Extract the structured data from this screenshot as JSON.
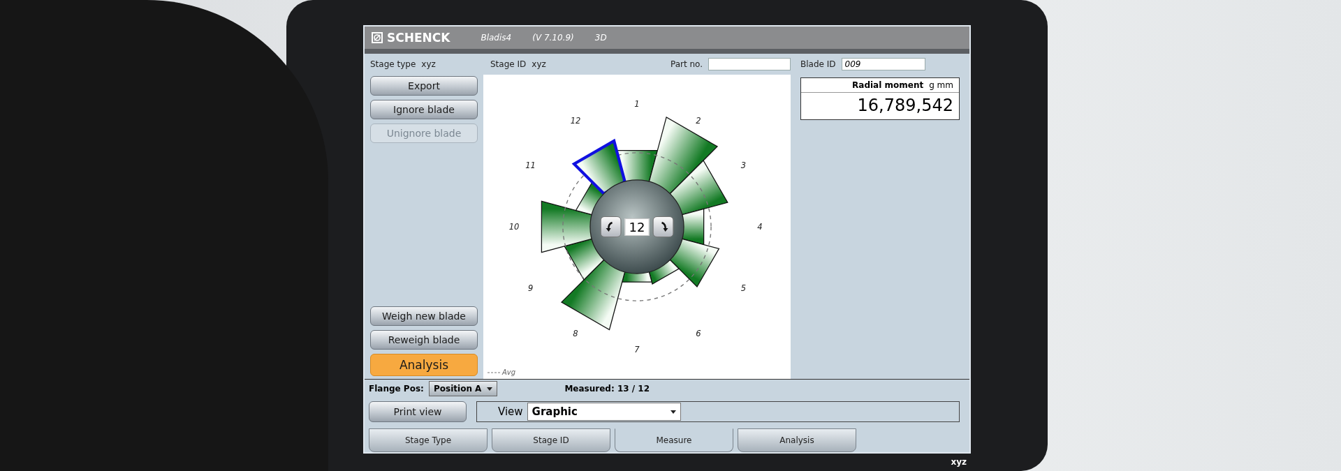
{
  "title_bar": {
    "logo": "SCHENCK",
    "app": "Bladis4",
    "version": "(V 7.10.9)",
    "mode": "3D"
  },
  "stage_type": {
    "label": "Stage type",
    "value": "xyz"
  },
  "stage_id": {
    "label": "Stage ID",
    "value": "xyz"
  },
  "part_no": {
    "label": "Part no."
  },
  "blade_id": {
    "label": "Blade ID",
    "value": "009"
  },
  "side_buttons_top": [
    {
      "label": "Export",
      "disabled": false
    },
    {
      "label": "Ignore blade",
      "disabled": false
    },
    {
      "label": "Unignore blade",
      "disabled": true
    }
  ],
  "side_buttons_bottom": [
    {
      "label": "Weigh new blade",
      "highlighted": false
    },
    {
      "label": "Reweigh blade",
      "highlighted": false
    },
    {
      "label": "Analysis",
      "highlighted": true
    }
  ],
  "chart": {
    "current_blade": "12",
    "legend": "Avg",
    "blades": [
      {
        "label": "1",
        "selected": false
      },
      {
        "label": "2",
        "selected": false
      },
      {
        "label": "3",
        "selected": false
      },
      {
        "label": "4",
        "selected": false
      },
      {
        "label": "5",
        "selected": false
      },
      {
        "label": "6",
        "selected": false
      },
      {
        "label": "7",
        "selected": false
      },
      {
        "label": "8",
        "selected": false
      },
      {
        "label": "9",
        "selected": false
      },
      {
        "label": "10",
        "selected": false
      },
      {
        "label": "11",
        "selected": false
      },
      {
        "label": "12",
        "selected": true
      }
    ]
  },
  "radial_moment": {
    "label": "Radial moment",
    "unit": "g mm",
    "value": "16,789,542"
  },
  "flange_pos": {
    "label": "Flange Pos:",
    "value": "Position A"
  },
  "measured": "Measured: 13 / 12",
  "print_button": "Print view",
  "view": {
    "label": "View",
    "value": "Graphic"
  },
  "tabs": [
    {
      "label": "Stage Type",
      "selected": false
    },
    {
      "label": "Stage ID",
      "selected": false
    },
    {
      "label": "Measure",
      "selected": true
    },
    {
      "label": "Analysis",
      "selected": false
    }
  ],
  "footer": "xyz"
}
